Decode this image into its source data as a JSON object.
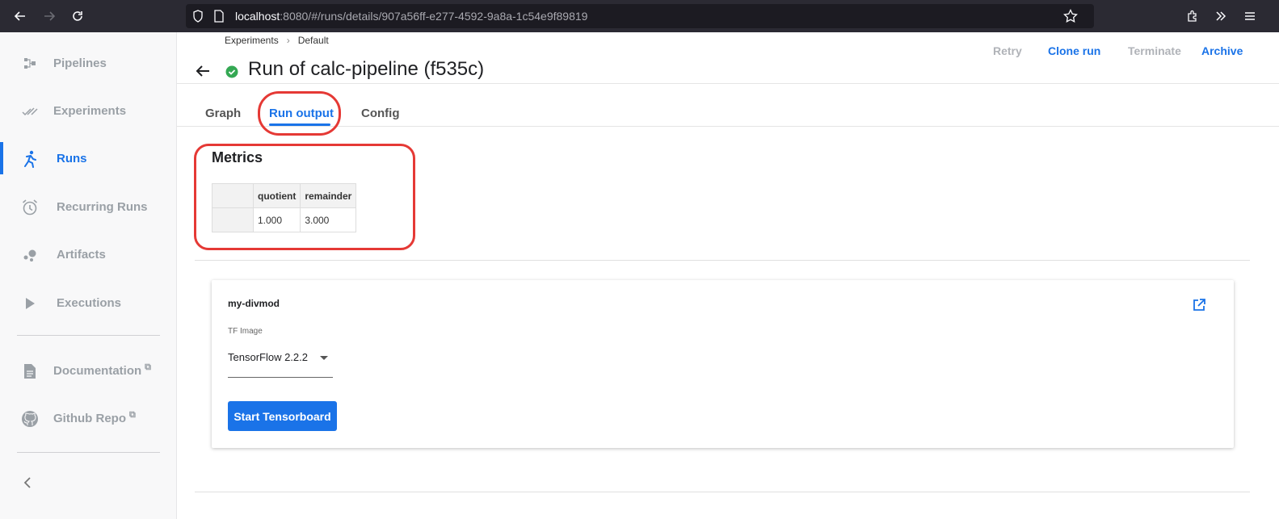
{
  "browser": {
    "url_host": "localhost",
    "url_rest": ":8080/#/runs/details/907a56ff-e277-4592-9a8a-1c54e9f89819"
  },
  "sidebar": {
    "items": [
      {
        "label": "Pipelines",
        "icon": "pipelines-icon"
      },
      {
        "label": "Experiments",
        "icon": "experiments-icon"
      },
      {
        "label": "Runs",
        "icon": "runs-icon",
        "active": true
      },
      {
        "label": "Recurring Runs",
        "icon": "alarm-clock-icon"
      },
      {
        "label": "Artifacts",
        "icon": "artifacts-icon"
      },
      {
        "label": "Executions",
        "icon": "play-icon"
      }
    ],
    "links": [
      {
        "label": "Documentation",
        "icon": "document-icon"
      },
      {
        "label": "Github Repo",
        "icon": "github-icon"
      }
    ]
  },
  "breadcrumb": {
    "items": [
      "Experiments",
      "Default"
    ],
    "separator": "›"
  },
  "page": {
    "title": "Run of calc-pipeline (f535c)",
    "status": "succeeded"
  },
  "actions": {
    "retry": "Retry",
    "clone": "Clone run",
    "terminate": "Terminate",
    "archive": "Archive"
  },
  "tabs": [
    {
      "label": "Graph"
    },
    {
      "label": "Run output",
      "active": true
    },
    {
      "label": "Config"
    }
  ],
  "metrics": {
    "title": "Metrics",
    "columns": [
      "",
      "quotient",
      "remainder"
    ],
    "rows": [
      [
        "",
        "1.000",
        "3.000"
      ]
    ]
  },
  "card": {
    "title": "my-divmod",
    "select_label": "TF Image",
    "select_value": "TensorFlow 2.2.2",
    "button": "Start Tensorboard"
  },
  "colors": {
    "accent": "#1a73e8",
    "highlight": "#e53935",
    "success": "#34a853",
    "disabled": "#9aa0a6"
  }
}
